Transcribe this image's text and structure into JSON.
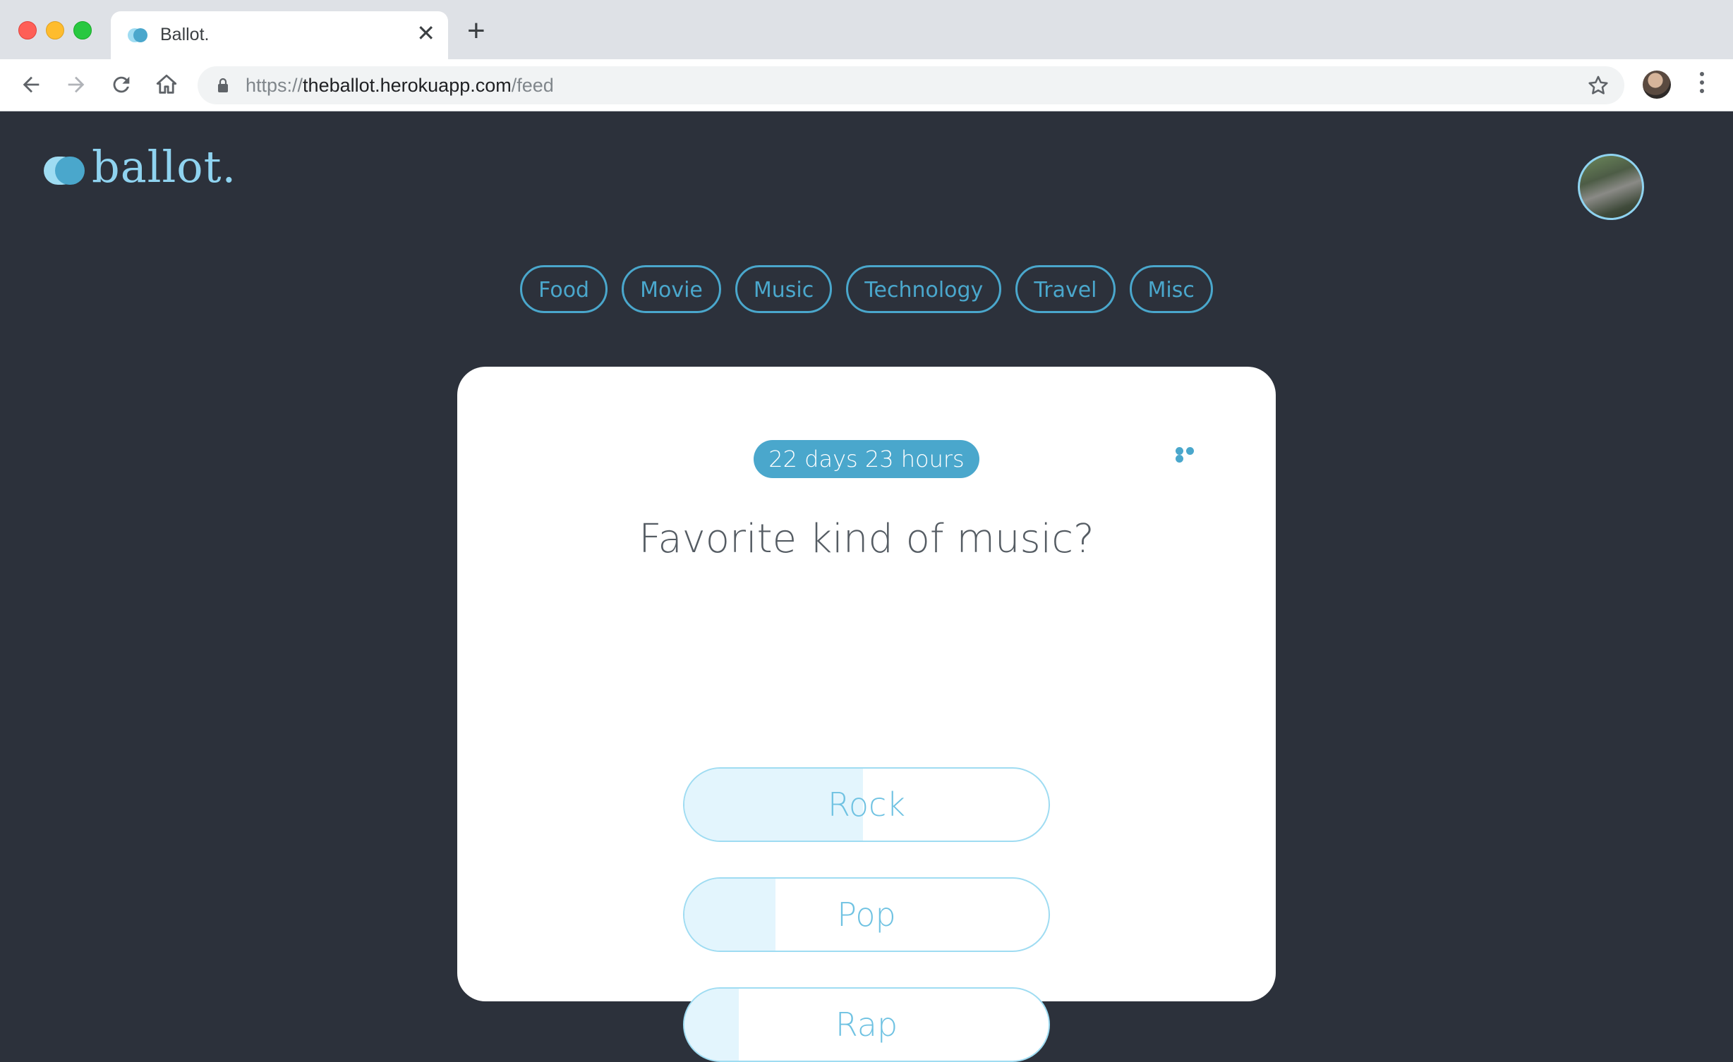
{
  "browser": {
    "tab_title": "Ballot.",
    "url_scheme": "https://",
    "url_host": "theballot.herokuapp.com",
    "url_path": "/feed"
  },
  "app": {
    "logo_text": "ballot.",
    "brand_color": "#4aa7cc",
    "accent_light": "#9fdcf2",
    "background": "#2c313b"
  },
  "categories": [
    "Food",
    "Movie",
    "Music",
    "Technology",
    "Travel",
    "Misc"
  ],
  "poll": {
    "time_remaining": "22 days 23 hours",
    "question": "Favorite kind of music?",
    "options": [
      {
        "label": "Rock",
        "vote_share": 0.49
      },
      {
        "label": "Pop",
        "vote_share": 0.25
      },
      {
        "label": "Rap",
        "vote_share": 0.15
      }
    ]
  }
}
